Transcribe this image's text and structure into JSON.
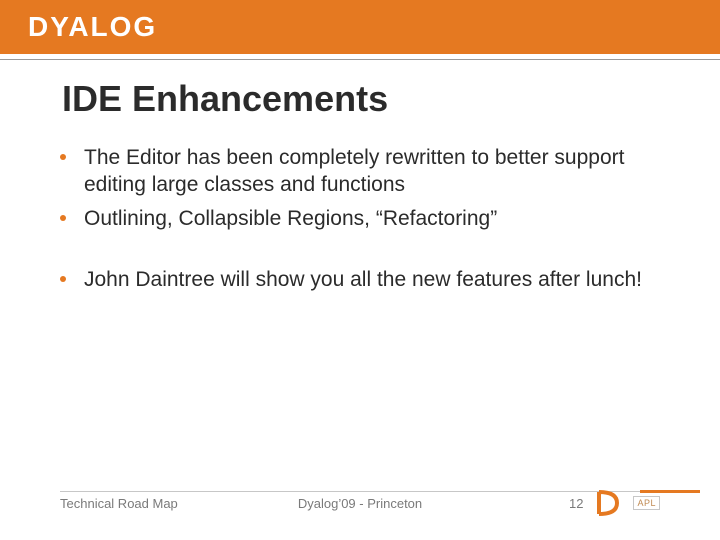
{
  "brand": {
    "name": "DYALOG"
  },
  "colors": {
    "accent": "#e57921"
  },
  "title": "IDE Enhancements",
  "bullets_group1": [
    "The Editor has been completely rewritten to better support editing large classes and functions",
    "Outlining, Collapsible Regions, “Refactoring”"
  ],
  "bullets_group2": [
    "John Daintree will show you all the new features after lunch!"
  ],
  "footer": {
    "left": "Technical Road Map",
    "center": "Dyalog’09 - Princeton",
    "page": "12",
    "badge": "APL"
  }
}
